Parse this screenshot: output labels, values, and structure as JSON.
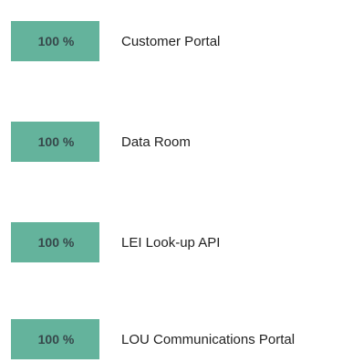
{
  "services": [
    {
      "uptime": "100 %",
      "name": "Customer Portal"
    },
    {
      "uptime": "100 %",
      "name": "Data Room"
    },
    {
      "uptime": "100 %",
      "name": "LEI Look-up API"
    },
    {
      "uptime": "100 %",
      "name": "LOU Communications Portal"
    }
  ],
  "colors": {
    "badge_background": "#64b39c",
    "badge_text": "#36474a",
    "label_text": "#222222"
  }
}
